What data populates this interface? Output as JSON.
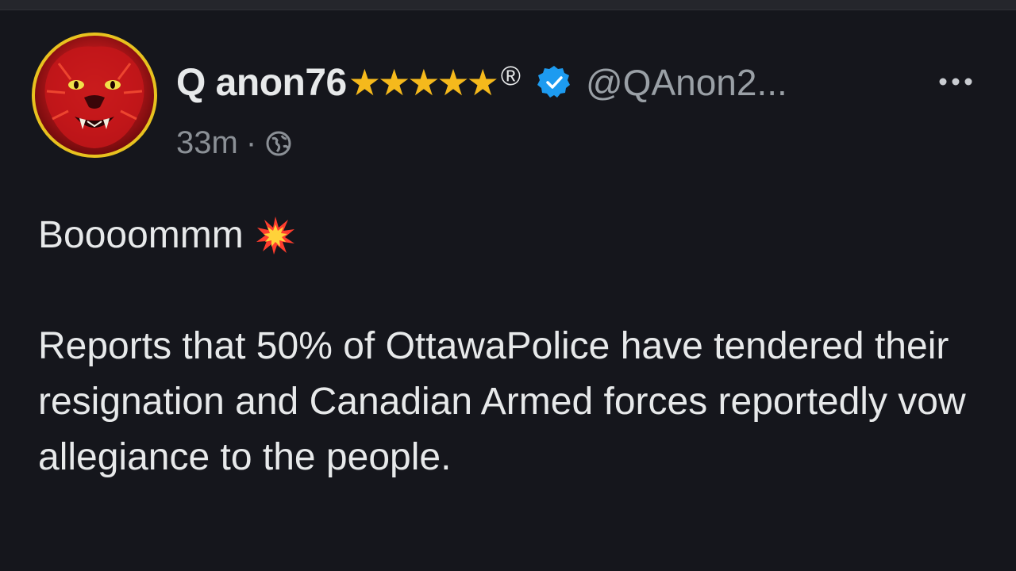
{
  "post": {
    "author": {
      "display_name": "Q anon76",
      "stars": "★★★★★",
      "registered_mark": "®",
      "verified_icon": "verified-badge-icon",
      "handle": "@QAnon2...",
      "avatar_icon": "red-lion-avatar"
    },
    "meta": {
      "time": "33m",
      "separator": "·",
      "visibility_icon": "globe-icon"
    },
    "more_icon": "more-options-icon",
    "content": {
      "line1": "Boooommm",
      "emoji_icon": "collision-emoji",
      "paragraph": "Reports that 50% of OttawaPolice have tendered their resignation and Canadian Armed forces reportedly vow allegiance to the people."
    }
  },
  "colors": {
    "background": "#15161c",
    "text": "#e7e9ea",
    "muted": "#8b9096",
    "stars": "#f5b91c",
    "verified": "#1d9bf0",
    "avatar_ring": "#e8c21f"
  }
}
